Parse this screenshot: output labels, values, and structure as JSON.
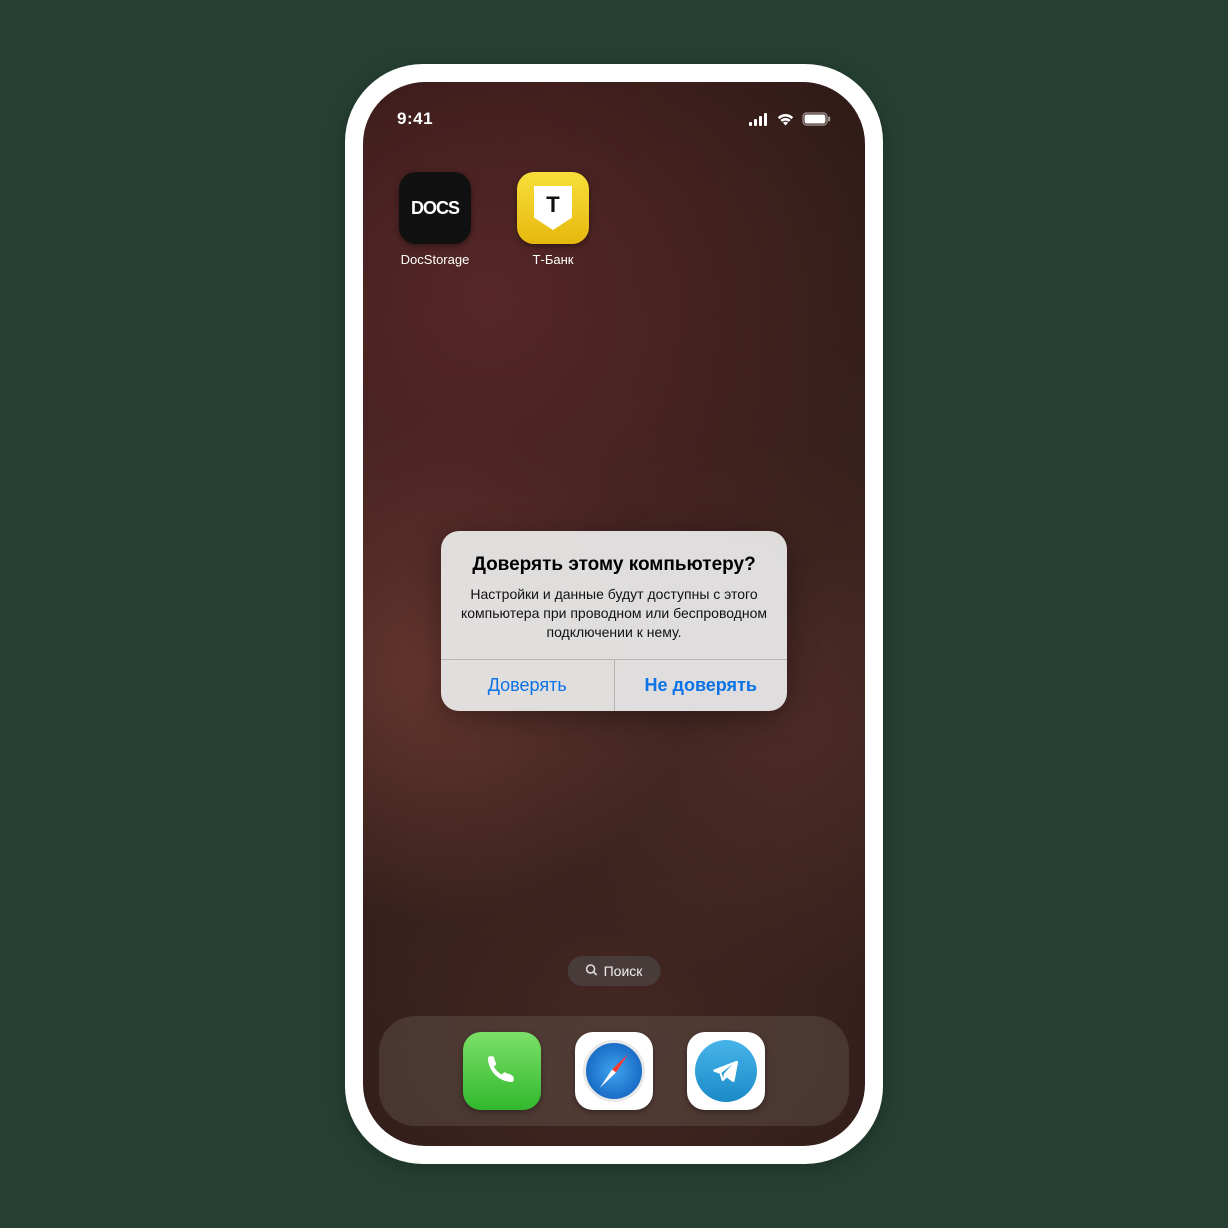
{
  "status": {
    "time": "9:41"
  },
  "home_apps": [
    {
      "label": "DocStorage",
      "icon_text": "DOCS"
    },
    {
      "label": "Т-Банк",
      "icon_text": "T"
    }
  ],
  "search": {
    "label": "Поиск"
  },
  "dock": {
    "apps": [
      "phone",
      "safari",
      "telegram"
    ]
  },
  "alert": {
    "title": "Доверять этому компьютеру?",
    "message": "Настройки и данные будут доступны с этого компьютера при проводном или беспроводном подключении к нему.",
    "trust": "Доверять",
    "dont_trust": "Не доверять"
  }
}
